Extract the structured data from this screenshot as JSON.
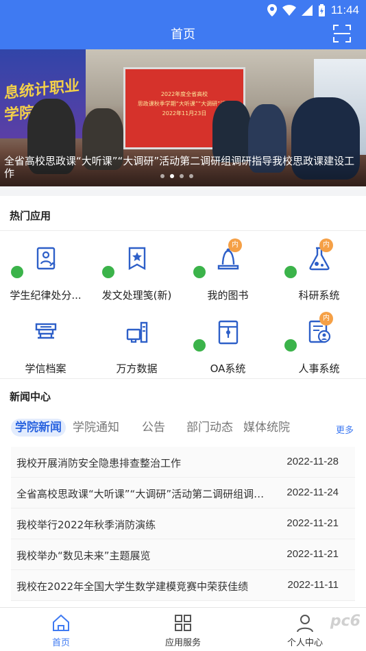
{
  "status_bar": {
    "time": "11:44"
  },
  "header": {
    "title": "首页",
    "scan_icon": "scan-icon"
  },
  "banner": {
    "caption": "全省高校思政课“大听课”“大调研”活动第二调研组调研指导我校思政课建设工作",
    "background_sign": "息统计职业学院",
    "screen_lines": [
      "2022年度全省高校",
      "思政课秋季学期“大听课”“大调研”活动",
      "2022年11月23日"
    ],
    "active_dot": 1
  },
  "hot_apps": {
    "title": "热门应用",
    "items": [
      {
        "label": "学生纪律处分...",
        "icon": "student-discipline-icon",
        "lock": true,
        "badge": ""
      },
      {
        "label": "发文处理笺(新)",
        "icon": "document-ribbon-icon",
        "lock": true,
        "badge": ""
      },
      {
        "label": "我的图书",
        "icon": "library-bell-icon",
        "lock": true,
        "badge": "内"
      },
      {
        "label": "科研系统",
        "icon": "flask-icon",
        "lock": true,
        "badge": "内"
      },
      {
        "label": "学信档案",
        "icon": "archive-icon",
        "lock": false,
        "badge": ""
      },
      {
        "label": "万方数据",
        "icon": "database-icon",
        "lock": false,
        "badge": ""
      },
      {
        "label": "OA系统",
        "icon": "oa-folder-icon",
        "lock": true,
        "badge": ""
      },
      {
        "label": "人事系统",
        "icon": "personnel-icon",
        "lock": true,
        "badge": "内"
      }
    ]
  },
  "news": {
    "title": "新闻中心",
    "tabs": [
      "学院新闻",
      "学院通知",
      "公告",
      "部门动态",
      "媒体统院"
    ],
    "active_tab": 0,
    "more": "更多",
    "items": [
      {
        "title": "我校开展消防安全隐患排查整治工作",
        "date": "2022-11-28"
      },
      {
        "title": "全省高校思政课“大听课”“大调研”活动第二调研组调研指导我校思政课建设工作",
        "date": "2022-11-24"
      },
      {
        "title": "我校举行2022年秋季消防演练",
        "date": "2022-11-21"
      },
      {
        "title": "我校举办“数见未来”主题展览",
        "date": "2022-11-21"
      },
      {
        "title": "我校在2022年全国大学生数学建模竞赛中荣获佳绩",
        "date": "2022-11-11"
      }
    ]
  },
  "bottom_nav": {
    "items": [
      {
        "label": "首页",
        "icon": "home-icon"
      },
      {
        "label": "应用服务",
        "icon": "apps-grid-icon"
      },
      {
        "label": "个人中心",
        "icon": "person-icon"
      }
    ],
    "active": 0
  },
  "watermark": "pc6",
  "colors": {
    "primary": "#3f7af2",
    "lock": "#3bb34a",
    "badge": "#f5a046",
    "icon_blue": "#2d5fc8"
  }
}
